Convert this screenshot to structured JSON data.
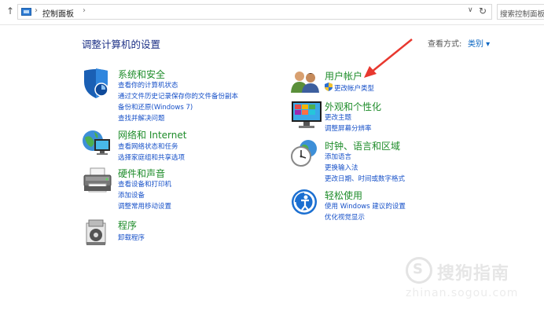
{
  "address_bar": {
    "up_arrow": "↑",
    "separator": "›",
    "crumb": "控制面板",
    "dropdown": "∨",
    "refresh": "↻",
    "search_placeholder": "搜索控制面板"
  },
  "header": {
    "title": "调整计算机的设置",
    "view_label": "查看方式:",
    "view_value": "类别 ▾"
  },
  "categories": {
    "system": {
      "title": "系统和安全",
      "links": [
        "查看你的计算机状态",
        "通过文件历史记录保存你的文件备份副本",
        "备份和还原(Windows 7)",
        "查找并解决问题"
      ]
    },
    "network": {
      "title": "网络和 Internet",
      "links": [
        "查看网络状态和任务",
        "选择家庭组和共享选项"
      ]
    },
    "hardware": {
      "title": "硬件和声音",
      "links": [
        "查看设备和打印机",
        "添加设备",
        "调整常用移动设置"
      ]
    },
    "programs": {
      "title": "程序",
      "links": [
        "卸载程序"
      ]
    },
    "user": {
      "title": "用户帐户",
      "links": [
        "更改帐户类型"
      ]
    },
    "appearance": {
      "title": "外观和个性化",
      "links": [
        "更改主题",
        "调整屏幕分辨率"
      ]
    },
    "clock": {
      "title": "时钟、语言和区域",
      "links": [
        "添加语言",
        "更换输入法",
        "更改日期、时间或数字格式"
      ]
    },
    "ease": {
      "title": "轻松使用",
      "links": [
        "使用 Windows 建议的设置",
        "优化视觉显示"
      ]
    }
  },
  "watermark": {
    "logo": "S",
    "text": "搜狗指南",
    "url": "zhinan.sogou.com"
  },
  "colors": {
    "category_title": "#1e8c2a",
    "link": "#1650c8",
    "page_title": "#1e3287",
    "annotation_arrow": "#e8382f"
  }
}
